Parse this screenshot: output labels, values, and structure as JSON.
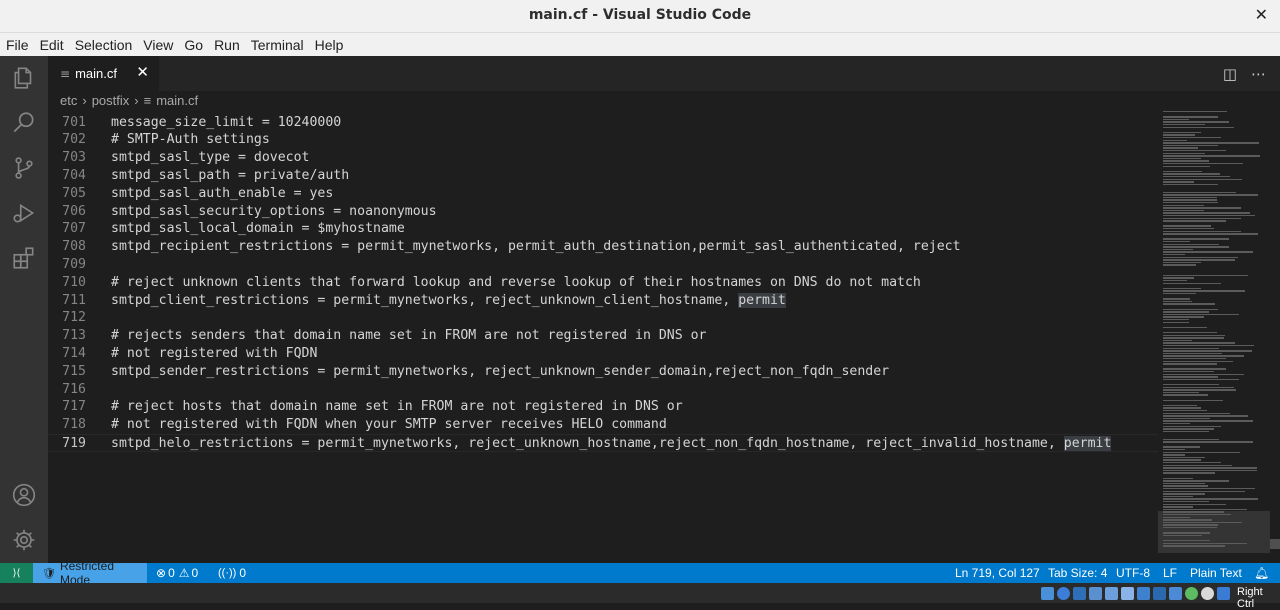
{
  "window": {
    "title": "main.cf - Visual Studio Code",
    "close_glyph": "✕"
  },
  "menu": [
    "File",
    "Edit",
    "Selection",
    "View",
    "Go",
    "Run",
    "Terminal",
    "Help"
  ],
  "activity_bar": {
    "top": [
      "explorer-icon",
      "search-icon",
      "source-control-icon",
      "run-debug-icon",
      "extensions-icon"
    ],
    "bottom": [
      "accounts-icon",
      "manage-gear-icon"
    ]
  },
  "tab": {
    "icon": "≡",
    "label": "main.cf",
    "close": "✕"
  },
  "tab_actions": {
    "split": "◫",
    "more": "⋯"
  },
  "breadcrumb": {
    "part1": "etc",
    "sep": "›",
    "part2": "postfix",
    "file_icon": "≡",
    "file": "main.cf"
  },
  "editor": {
    "lines": [
      {
        "n": "701",
        "text": "message_size_limit = 10240000"
      },
      {
        "n": "702",
        "text": "# SMTP-Auth settings"
      },
      {
        "n": "703",
        "text": "smtpd_sasl_type = dovecot"
      },
      {
        "n": "704",
        "text": "smtpd_sasl_path = private/auth"
      },
      {
        "n": "705",
        "text": "smtpd_sasl_auth_enable = yes"
      },
      {
        "n": "706",
        "text": "smtpd_sasl_security_options = noanonymous"
      },
      {
        "n": "707",
        "text": "smtpd_sasl_local_domain = $myhostname"
      },
      {
        "n": "708",
        "text": "smtpd_recipient_restrictions = permit_mynetworks, permit_auth_destination,permit_sasl_authenticated, reject"
      },
      {
        "n": "709",
        "text": ""
      },
      {
        "n": "710",
        "text": "# reject unknown clients that forward lookup and reverse lookup of their hostnames on DNS do not match"
      },
      {
        "n": "711",
        "text": "smtpd_client_restrictions = permit_mynetworks, reject_unknown_client_hostname, ",
        "hl": "permit"
      },
      {
        "n": "712",
        "text": ""
      },
      {
        "n": "713",
        "text": "# rejects senders that domain name set in FROM are not registered in DNS or"
      },
      {
        "n": "714",
        "text": "# not registered with FQDN"
      },
      {
        "n": "715",
        "text": "smtpd_sender_restrictions = permit_mynetworks, reject_unknown_sender_domain,reject_non_fqdn_sender"
      },
      {
        "n": "716",
        "text": ""
      },
      {
        "n": "717",
        "text": "# reject hosts that domain name set in FROM are not registered in DNS or"
      },
      {
        "n": "718",
        "text": "# not registered with FQDN when your SMTP server receives HELO command"
      },
      {
        "n": "719",
        "text": "smtpd_helo_restrictions = permit_mynetworks, reject_unknown_hostname,reject_non_fqdn_hostname, reject_invalid_hostname, ",
        "hl": "permit",
        "active": true
      }
    ]
  },
  "status": {
    "remote_glyph": "⟩⟨",
    "restricted": "Restricted Mode",
    "errors": "0",
    "warnings": "0",
    "ports": "0",
    "position": "Ln 719, Col 127",
    "tab_size": "Tab Size: 4",
    "encoding": "UTF-8",
    "eol": "LF",
    "language": "Plain Text",
    "bell": "🔔︎"
  },
  "taskbar": {
    "right_ctrl": "Right Ctrl"
  },
  "colors": {
    "accent": "#007acc",
    "restricted": "#47a2e7",
    "remote": "#16825d",
    "editor_bg": "#1e1e1e"
  }
}
